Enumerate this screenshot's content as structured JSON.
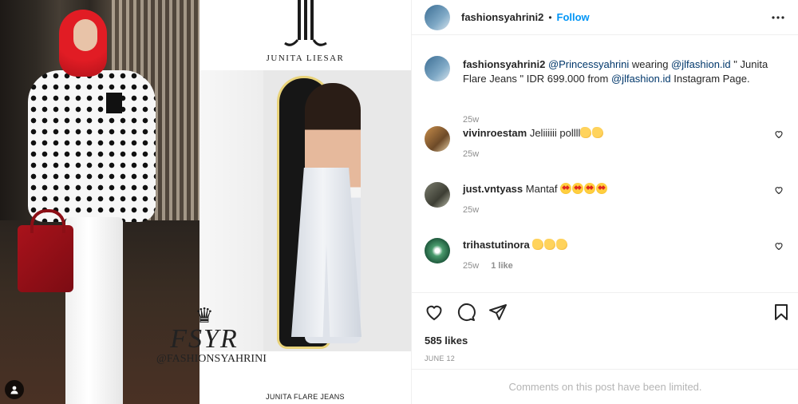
{
  "post": {
    "username": "fashionsyahrini2",
    "separator": "•",
    "follow_label": "Follow",
    "more_icon": "more-horizontal-icon"
  },
  "media": {
    "brand_name": "JUNITA LIESAR",
    "logo_monogram": "FSYR",
    "logo_handle": "@FASHIONSYAHRINI",
    "bottom_caption": "JUNITA FLARE JEANS"
  },
  "caption": {
    "username": "fashionsyahrini2",
    "text_mention": "@Princessyahrini",
    "text_part1": " wearing ",
    "text_mention2": "@jlfashion.id",
    "text_part2": " \" Junita Flare Jeans \" IDR 699.000 from ",
    "text_mention3": "@jlfashion.id",
    "text_part3": " Instagram Page.",
    "time": "25w"
  },
  "comments": [
    {
      "username": "vivinroestam",
      "text": "Jeliiiiii pollll",
      "emoji": [
        "clap",
        "clap"
      ],
      "time": "25w",
      "likes": ""
    },
    {
      "username": "just.vntyass",
      "text": "Mantaf",
      "emoji": [
        "star",
        "star",
        "star",
        "star"
      ],
      "time": "25w",
      "likes": ""
    },
    {
      "username": "trihastutinora",
      "text": "",
      "emoji": [
        "clap",
        "clap",
        "clap"
      ],
      "time": "25w",
      "likes": "1 like"
    }
  ],
  "actions": {
    "like_icon": "heart-icon",
    "comment_icon": "comment-icon",
    "share_icon": "share-icon",
    "save_icon": "bookmark-icon",
    "likes": "585 likes",
    "date": "JUNE 12"
  },
  "footer": {
    "limited_text": "Comments on this post have been limited."
  },
  "colors": {
    "accent": "#0095f6",
    "link": "#00376b",
    "muted": "#8e8e8e",
    "border": "#efefef"
  }
}
